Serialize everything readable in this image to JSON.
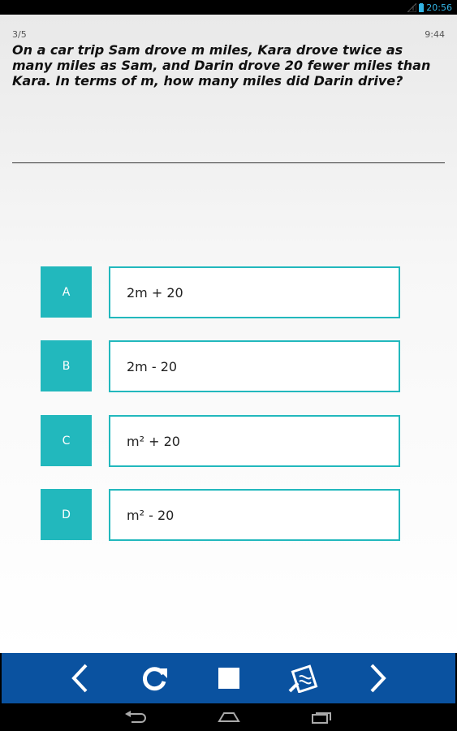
{
  "status_bar": {
    "time": "20:56",
    "icons": [
      "signal-icon",
      "battery-icon"
    ]
  },
  "question": {
    "counter": "3/5",
    "timer": "9:44",
    "text": "On a car trip Sam drove m miles, Kara drove twice as many miles as Sam, and Darin drove 20 fewer miles than Kara. In terms of m, how many miles did Darin drive?"
  },
  "options": [
    {
      "letter": "A",
      "text": "2m + 20"
    },
    {
      "letter": "B",
      "text": "2m - 20"
    },
    {
      "letter": "C",
      "text": "m² + 20"
    },
    {
      "letter": "D",
      "text": "m² - 20"
    }
  ],
  "toolbar": {
    "buttons": [
      "back-arrow-icon",
      "refresh-icon",
      "stop-icon",
      "notes-icon",
      "forward-arrow-icon"
    ]
  },
  "nav_bar": {
    "buttons": [
      "back-icon",
      "home-icon",
      "recent-apps-icon"
    ]
  },
  "colors": {
    "accent": "#22b8bd",
    "toolbar": "#0a52a0",
    "status_text": "#33b5e5"
  }
}
